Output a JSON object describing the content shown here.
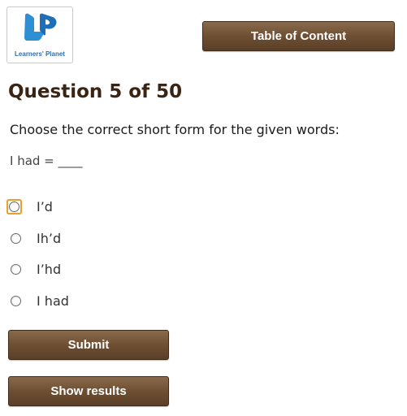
{
  "logo": {
    "text": "Learners' Planet",
    "brand_color": "#2f6fae"
  },
  "header": {
    "toc_button": "Table of Content"
  },
  "question": {
    "title": "Question 5 of 50",
    "instruction": "Choose the correct short form for the given words:",
    "prompt": "I had = ____"
  },
  "options": [
    {
      "label": "I’d",
      "focused": true
    },
    {
      "label": "Ih’d",
      "focused": false
    },
    {
      "label": "I’hd",
      "focused": false
    },
    {
      "label": "I had",
      "focused": false
    }
  ],
  "actions": {
    "submit": "Submit",
    "show_results": "Show results"
  },
  "colors": {
    "button": "#6e4f33",
    "title": "#3a2414",
    "focus": "#e4a22a"
  }
}
